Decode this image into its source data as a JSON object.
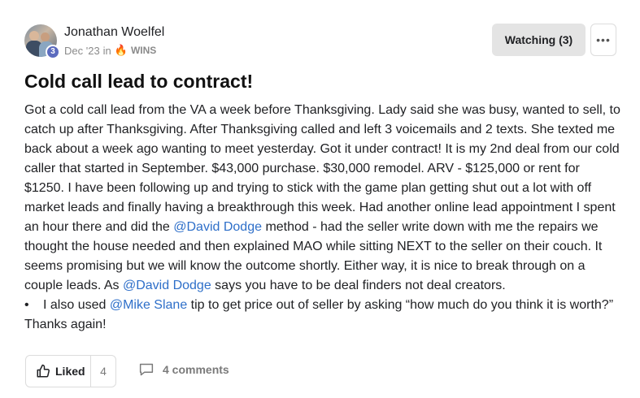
{
  "post": {
    "author": {
      "name": "Jonathan Woelfel",
      "level": "3"
    },
    "meta": {
      "date": "Dec '23",
      "in_text": "in",
      "category_icon": "fire-icon",
      "category": "WINS"
    },
    "watch_label": "Watching (3)",
    "more_label": "•••",
    "title": "Cold call lead to contract!",
    "body": {
      "p1": "Got a cold call lead from the VA a week before Thanksgiving. Lady said she was busy, wanted to sell, to catch up after Thanksgiving. After Thanksgiving called and left 3 voicemails and 2 texts. She texted me back about a week ago wanting to meet yesterday. Got it under contract! It is my 2nd deal from our cold caller that started in September. $43,000 purchase. $30,000 remodel. ARV - $125,000 or rent for $1250. I have been following up and trying to stick with the game plan getting shut out a lot with off market leads and finally having a breakthrough this week. Had another online lead appointment I spent an hour there and did the ",
      "mention1": "@David Dodge",
      "p2": " method - had the seller write down with me the repairs we thought the house needed and then explained MAO while sitting NEXT to the seller on their couch. It seems promising but we will know the outcome shortly. Either way, it is nice to break through on a couple leads. As ",
      "mention2": "@David Dodge",
      "p3": " says you have to be deal finders not deal creators.",
      "bullet_marker": "•",
      "bullet_pre": "I also used ",
      "mention3": "@Mike Slane",
      "bullet_post": " tip to get price out of seller by asking “how much do you think it is worth?”",
      "closing": "Thanks again!"
    },
    "actions": {
      "like_label": "Liked",
      "like_count": "4",
      "comments_label": "4 comments"
    }
  },
  "colors": {
    "mention": "#2e6fc9",
    "level_badge": "#5b6bbf",
    "watch_bg": "#e4e4e4"
  }
}
